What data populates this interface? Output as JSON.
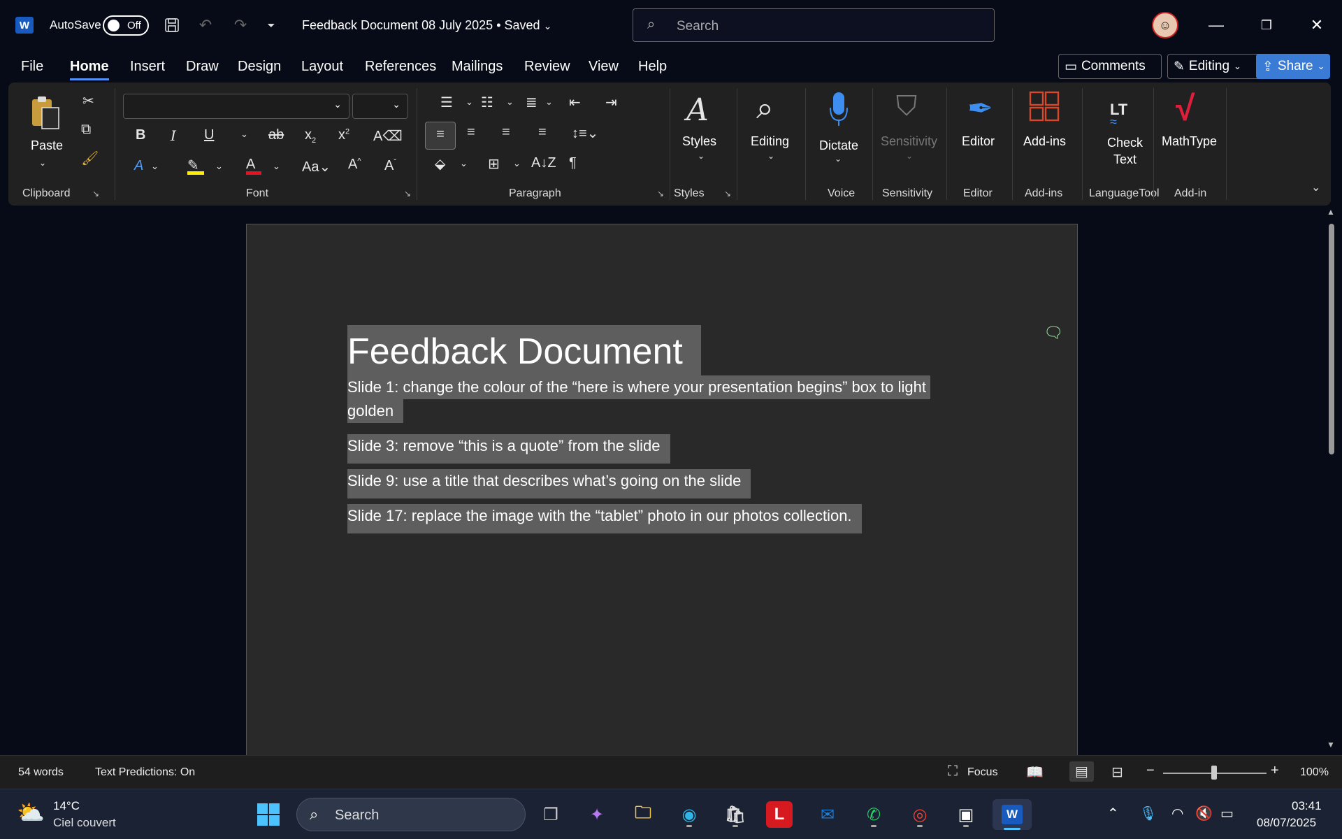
{
  "titlebar": {
    "app_icon": "W",
    "autosave_label": "AutoSave",
    "autosave_state": "Off",
    "document_title": "Feedback Document 08 July 2025",
    "save_status": "Saved",
    "search_placeholder": "Search"
  },
  "tabs": [
    "File",
    "Home",
    "Insert",
    "Draw",
    "Design",
    "Layout",
    "References",
    "Mailings",
    "Review",
    "View",
    "Help"
  ],
  "active_tab": "Home",
  "actions": {
    "comments": "Comments",
    "editing": "Editing",
    "share": "Share"
  },
  "ribbon": {
    "clipboard": {
      "paste": "Paste",
      "label": "Clipboard"
    },
    "font": {
      "label": "Font",
      "font_name": "",
      "font_size": ""
    },
    "paragraph": {
      "label": "Paragraph"
    },
    "styles": {
      "button": "Styles",
      "label": "Styles"
    },
    "editing": {
      "button": "Editing"
    },
    "voice": {
      "button": "Dictate",
      "label": "Voice"
    },
    "sensitivity": {
      "button": "Sensitivity",
      "label": "Sensitivity"
    },
    "editor": {
      "button": "Editor",
      "label": "Editor"
    },
    "addins": {
      "button": "Add-ins",
      "label": "Add-ins"
    },
    "languagetool": {
      "button_line1": "Check",
      "button_line2": "Text",
      "label": "LanguageTool",
      "icon_text": "LT"
    },
    "mathtype": {
      "button": "MathType",
      "label": "Add-in"
    }
  },
  "document": {
    "heading": "Feedback Document",
    "paragraphs": [
      "Slide 1: change the colour of the “here is where your presentation begins” box to light",
      "golden",
      "Slide 3: remove “this is a quote” from the slide",
      "Slide 9: use a title that describes what’s going on the slide",
      "Slide 17: replace the image with the “tablet” photo in our photos collection."
    ]
  },
  "statusbar": {
    "word_count": "54 words",
    "text_predictions": "Text Predictions: On",
    "focus": "Focus",
    "zoom": "100%",
    "zoom_minus": "−",
    "zoom_plus": "+"
  },
  "taskbar": {
    "temperature": "14°C",
    "weather": "Ciel couvert",
    "search_placeholder": "Search",
    "time": "03:41",
    "date": "08/07/2025"
  }
}
